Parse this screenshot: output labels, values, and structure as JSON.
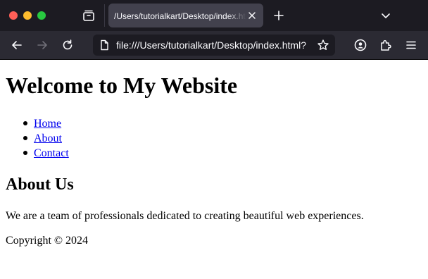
{
  "browser": {
    "tab": {
      "title": "/Users/tutorialkart/Desktop/index.html"
    },
    "address_bar": {
      "url": "file:///Users/tutorialkart/Desktop/index.html?"
    },
    "icons": {
      "tabs_list": "tabs-list-icon",
      "tab_close": "close-icon",
      "new_tab": "plus-icon",
      "tab_overflow": "chevron-down-icon",
      "back": "arrow-left-icon",
      "forward": "arrow-right-icon",
      "reload": "reload-icon",
      "page": "page-icon",
      "bookmark": "star-icon",
      "account": "account-icon",
      "extensions": "puzzle-icon",
      "menu": "hamburger-menu-icon"
    },
    "colors": {
      "titlebar": "#1c1b22",
      "toolbar": "#2b2a33",
      "active_tab": "#42414d",
      "close_dot": "#ff5f57",
      "minimize_dot": "#febc2e",
      "zoom_dot": "#28c840"
    }
  },
  "page": {
    "heading": "Welcome to My Website",
    "nav_links": [
      "Home",
      "About",
      "Contact"
    ],
    "section_heading": "About Us",
    "paragraph": "We are a team of professionals dedicated to creating beautiful web experiences.",
    "footer": "Copyright © 2024",
    "colors": {
      "link": "#0000ee",
      "text": "#000000",
      "background": "#ffffff"
    }
  }
}
